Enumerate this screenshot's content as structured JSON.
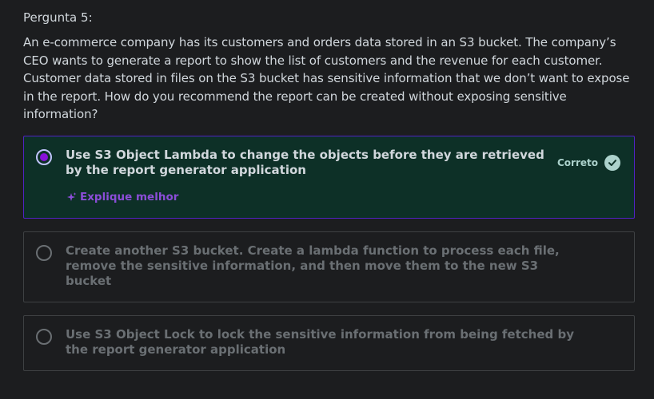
{
  "question": {
    "label": "Pergunta 5:",
    "text": "An e-commerce company has its customers and orders data stored in an S3 bucket. The company’s CEO wants to generate a report to show the list of customers and the revenue for each customer. Customer data stored in files on the S3 bucket has sensitive information that we don’t want to expose in the report. How do you recommend the report can be created without exposing sensitive information?"
  },
  "answers": [
    {
      "text": "Use S3 Object Lambda to change the objects before they are retrieved by the report generator application",
      "selected": true,
      "status": "Correto",
      "explain_label": "Explique melhor"
    },
    {
      "text": "Create another S3 bucket. Create a lambda function to process each file, remove the sensitive information, and then move them to the new S3 bucket",
      "selected": false
    },
    {
      "text": "Use S3 Object Lock to lock the sensitive information from being fetched by the report generator application",
      "selected": false
    }
  ],
  "colors": {
    "background": "#1c1d1f",
    "correct_bg": "#0d3027",
    "selected_border": "#5022c3",
    "radio_dot": "#8710d8",
    "correct_badge": "#acd2cc",
    "explain_link": "#8b4dd8"
  },
  "icons": {
    "status": "check-circle-icon",
    "explain": "sparkle-icon"
  }
}
